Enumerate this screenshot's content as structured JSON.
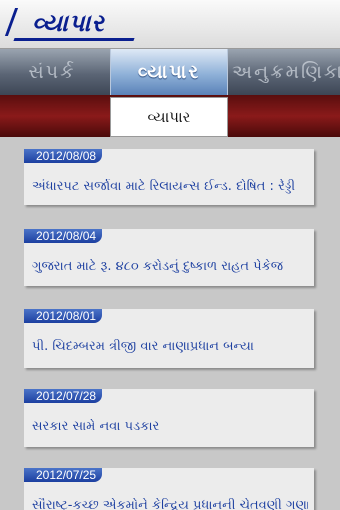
{
  "header": {
    "logo_text": "વ્યાપાર"
  },
  "tabs": {
    "left": "સંપર્ક",
    "active": "વ્યાપાર",
    "right": "અનુક્રમણિકા"
  },
  "section": {
    "label": "વ્યાપાર"
  },
  "news": [
    {
      "date": "2012/08/08",
      "title": "અંધારપટ સર્જાવા માટે રિલાયન્સ ઈન્ડ. દોષિત : રેડ્ડી"
    },
    {
      "date": "2012/08/04",
      "title": "ગુજરાત માટે રૂ. ૪૮૦ કરોડનું દુષ્કાળ રાહત પેકેજ"
    },
    {
      "date": "2012/08/01",
      "title": "પી. ચિદમ્બરમ ત્રીજી વાર નાણાપ્રધાન બન્યા"
    },
    {
      "date": "2012/07/28",
      "title": "સરકાર સામે નવા પડકાર"
    },
    {
      "date": "2012/07/25",
      "title": "સૌરાષ્ટ્ર-કચ્છ એકમોને કેન્દ્રિય પ્રધાનની ચેતવણી ગણાય"
    }
  ]
}
